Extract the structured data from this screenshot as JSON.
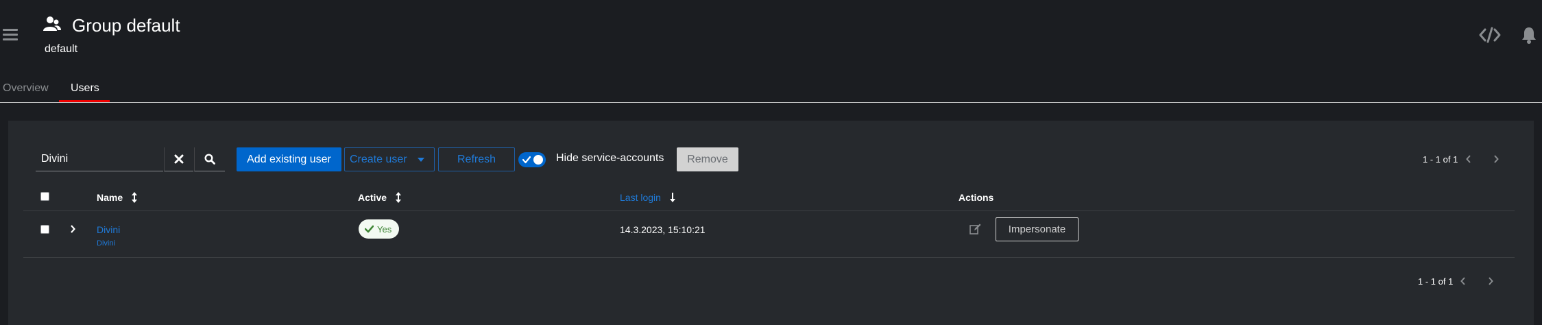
{
  "header": {
    "title": "Group default",
    "subtitle": "default",
    "icons": {
      "menu": "hamburger-icon",
      "group": "users-icon",
      "code": "code-icon",
      "notifications": "bell-icon"
    }
  },
  "tabs": [
    {
      "label": "Overview",
      "active": false
    },
    {
      "label": "Users",
      "active": true
    }
  ],
  "toolbar": {
    "search_value": "Divini",
    "add_existing_label": "Add existing user",
    "create_user_label": "Create user",
    "refresh_label": "Refresh",
    "hide_service_accounts_label": "Hide service-accounts",
    "hide_service_accounts_on": true,
    "remove_label": "Remove",
    "pagination": "1 - 1 of 1"
  },
  "table": {
    "columns": {
      "name": "Name",
      "active": "Active",
      "last_login": "Last login",
      "actions": "Actions"
    },
    "rows": [
      {
        "name": "Divini",
        "sub": "Divini",
        "active": "Yes",
        "last_login": "14.3.2023, 15:10:21",
        "impersonate_label": "Impersonate"
      }
    ]
  },
  "footer": {
    "pagination": "1 - 1 of 1"
  },
  "colors": {
    "background": "#1b1d21",
    "card": "#26292d",
    "primary": "#0066cc",
    "link": "#1f7ad8",
    "tab_active": "#ee0000",
    "success": "#3e8635"
  }
}
